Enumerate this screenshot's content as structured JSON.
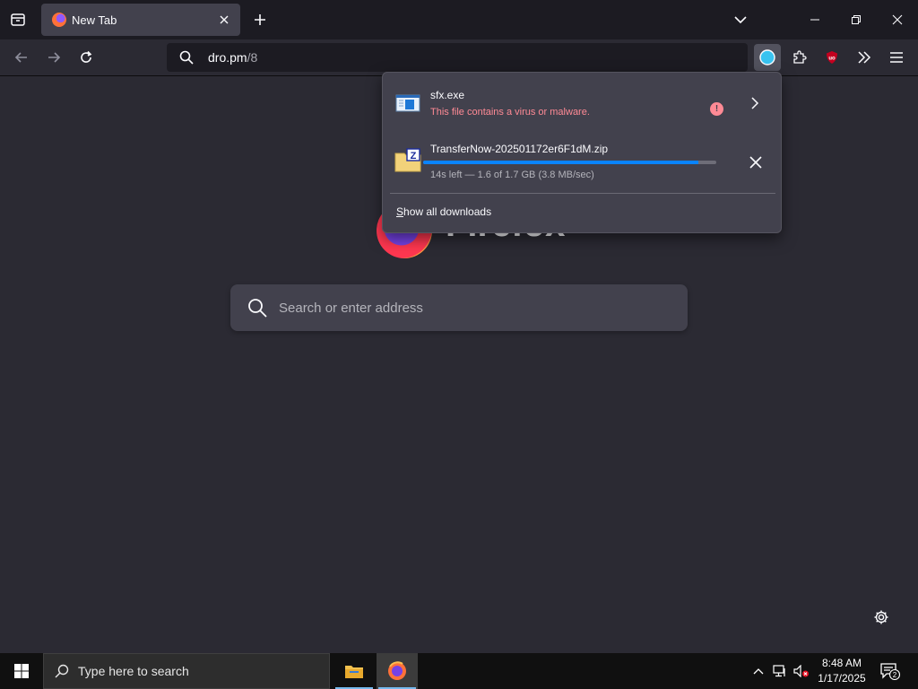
{
  "browser": {
    "tab": {
      "title": "New Tab"
    },
    "url": {
      "host": "dro.pm",
      "path": "/8"
    }
  },
  "newtab": {
    "brand": "Firefox",
    "search_placeholder": "Search or enter address"
  },
  "downloads_panel": {
    "items": [
      {
        "name": "sfx.exe",
        "status": "This file contains a virus or malware.",
        "badge": "!"
      },
      {
        "name": "TransferNow-202501172er6F1dM.zip",
        "status": "14s left — 1.6 of 1.7 GB (3.8 MB/sec)",
        "progress": 0.94
      }
    ],
    "show_all_prefix": "S",
    "show_all_rest": "how all downloads"
  },
  "taskbar": {
    "search_placeholder": "Type here to search",
    "time": "8:48 AM",
    "date": "1/17/2025",
    "notification_count": "2"
  },
  "colors": {
    "accent": "#0a84ff",
    "warning": "#ff8a95",
    "download_indicator": "#39c3f0"
  }
}
